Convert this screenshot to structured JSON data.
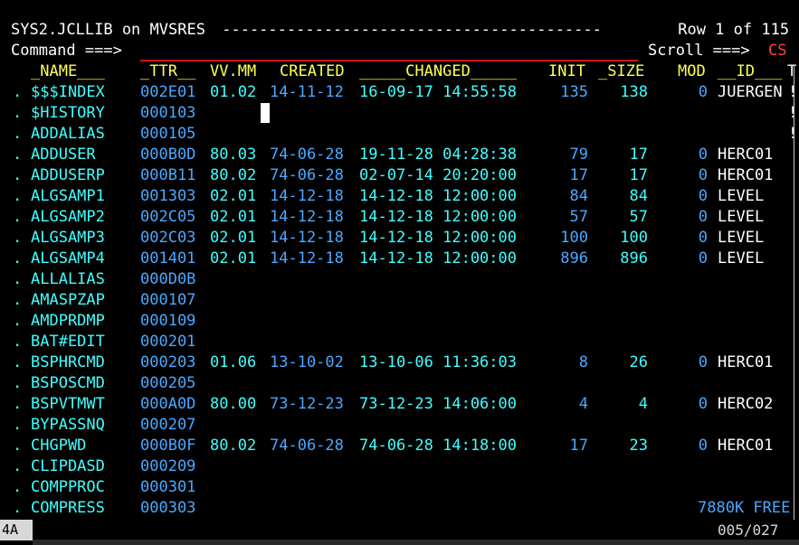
{
  "header": {
    "title": "SYS2.JCLLIB on MVSRES",
    "dashes": " -----------------------------------------",
    "row_info": " Row 1 of 115"
  },
  "command": {
    "label": "Command ===>",
    "value": "",
    "scroll_label": "Scroll ===>",
    "scroll_value": "CS"
  },
  "columns": {
    "name": "_NAME___",
    "ttr": "_TTR__",
    "vvmm": "VV.MM",
    "created": "CREATED",
    "changed": "_____CHANGED_____",
    "init": "INIT",
    "size": "_SIZE",
    "mod": "MOD",
    "id": "__ID___"
  },
  "rows": [
    {
      "sel": ".",
      "name": "$$$INDEX",
      "ttr": "002E01",
      "vv": "01.02",
      "created": "14-11-12",
      "changed": "16-09-17 14:55:58",
      "init": "135",
      "size": "138",
      "mod": "0",
      "id": "JUERGEN",
      "flag": "!"
    },
    {
      "sel": ".",
      "name": "$HISTORY",
      "ttr": "000103",
      "vv": "",
      "created": "",
      "changed": "",
      "init": "",
      "size": "",
      "mod": "",
      "id": "",
      "flag": "!"
    },
    {
      "sel": ".",
      "name": "ADDALIAS",
      "ttr": "000105",
      "vv": "",
      "created": "",
      "changed": "",
      "init": "",
      "size": "",
      "mod": "",
      "id": "",
      "flag": "!"
    },
    {
      "sel": ".",
      "name": "ADDUSER",
      "ttr": "000B0D",
      "vv": "80.03",
      "created": "74-06-28",
      "changed": "19-11-28 04:28:38",
      "init": "79",
      "size": "17",
      "mod": "0",
      "id": "HERC01",
      "flag": ""
    },
    {
      "sel": ".",
      "name": "ADDUSERP",
      "ttr": "000B11",
      "vv": "80.02",
      "created": "74-06-28",
      "changed": "02-07-14 20:20:00",
      "init": "17",
      "size": "17",
      "mod": "0",
      "id": "HERC01",
      "flag": ""
    },
    {
      "sel": ".",
      "name": "ALGSAMP1",
      "ttr": "001303",
      "vv": "02.01",
      "created": "14-12-18",
      "changed": "14-12-18 12:00:00",
      "init": "84",
      "size": "84",
      "mod": "0",
      "id": "LEVEL",
      "flag": ""
    },
    {
      "sel": ".",
      "name": "ALGSAMP2",
      "ttr": "002C05",
      "vv": "02.01",
      "created": "14-12-18",
      "changed": "14-12-18 12:00:00",
      "init": "57",
      "size": "57",
      "mod": "0",
      "id": "LEVEL",
      "flag": ""
    },
    {
      "sel": ".",
      "name": "ALGSAMP3",
      "ttr": "002C03",
      "vv": "02.01",
      "created": "14-12-18",
      "changed": "14-12-18 12:00:00",
      "init": "100",
      "size": "100",
      "mod": "0",
      "id": "LEVEL",
      "flag": ""
    },
    {
      "sel": ".",
      "name": "ALGSAMP4",
      "ttr": "001401",
      "vv": "02.01",
      "created": "14-12-18",
      "changed": "14-12-18 12:00:00",
      "init": "896",
      "size": "896",
      "mod": "0",
      "id": "LEVEL",
      "flag": ""
    },
    {
      "sel": ".",
      "name": "ALLALIAS",
      "ttr": "000D0B",
      "vv": "",
      "created": "",
      "changed": "",
      "init": "",
      "size": "",
      "mod": "",
      "id": "",
      "flag": ""
    },
    {
      "sel": ".",
      "name": "AMASPZAP",
      "ttr": "000107",
      "vv": "",
      "created": "",
      "changed": "",
      "init": "",
      "size": "",
      "mod": "",
      "id": "",
      "flag": ""
    },
    {
      "sel": ".",
      "name": "AMDPRDMP",
      "ttr": "000109",
      "vv": "",
      "created": "",
      "changed": "",
      "init": "",
      "size": "",
      "mod": "",
      "id": "",
      "flag": ""
    },
    {
      "sel": ".",
      "name": "BAT#EDIT",
      "ttr": "000201",
      "vv": "",
      "created": "",
      "changed": "",
      "init": "",
      "size": "",
      "mod": "",
      "id": "",
      "flag": ""
    },
    {
      "sel": ".",
      "name": "BSPHRCMD",
      "ttr": "000203",
      "vv": "01.06",
      "created": "13-10-02",
      "changed": "13-10-06 11:36:03",
      "init": "8",
      "size": "26",
      "mod": "0",
      "id": "HERC01",
      "flag": ""
    },
    {
      "sel": ".",
      "name": "BSPOSCMD",
      "ttr": "000205",
      "vv": "",
      "created": "",
      "changed": "",
      "init": "",
      "size": "",
      "mod": "",
      "id": "",
      "flag": ""
    },
    {
      "sel": ".",
      "name": "BSPVTMWT",
      "ttr": "000A0D",
      "vv": "80.00",
      "created": "73-12-23",
      "changed": "73-12-23 14:06:00",
      "init": "4",
      "size": "4",
      "mod": "0",
      "id": "HERC02",
      "flag": ""
    },
    {
      "sel": ".",
      "name": "BYPASSNQ",
      "ttr": "000207",
      "vv": "",
      "created": "",
      "changed": "",
      "init": "",
      "size": "",
      "mod": "",
      "id": "",
      "flag": ""
    },
    {
      "sel": ".",
      "name": "CHGPWD",
      "ttr": "000B0F",
      "vv": "80.02",
      "created": "74-06-28",
      "changed": "74-06-28 14:18:00",
      "init": "17",
      "size": "23",
      "mod": "0",
      "id": "HERC01",
      "flag": ""
    },
    {
      "sel": ".",
      "name": "CLIPDASD",
      "ttr": "000209",
      "vv": "",
      "created": "",
      "changed": "",
      "init": "",
      "size": "",
      "mod": "",
      "id": "",
      "flag": ""
    },
    {
      "sel": ".",
      "name": "COMPPROC",
      "ttr": "000301",
      "vv": "",
      "created": "",
      "changed": "",
      "init": "",
      "size": "",
      "mod": "",
      "id": "",
      "flag": ""
    },
    {
      "sel": ".",
      "name": "COMPRESS",
      "ttr": "000303",
      "vv": "",
      "created": "",
      "changed": "",
      "init": "",
      "size": "",
      "mod": "",
      "id": "",
      "flag": ""
    }
  ],
  "free_space": "7880K FREE",
  "edge_marker": "T",
  "status": {
    "session": "4A",
    "cursor_pos": "005/027"
  },
  "colors": {
    "background": "#000000",
    "text_white": "#ffffff",
    "text_yellow": "#ffff54",
    "text_turquoise": "#40ffff",
    "text_blue": "#4aa8ff",
    "text_red": "#ff4040"
  }
}
